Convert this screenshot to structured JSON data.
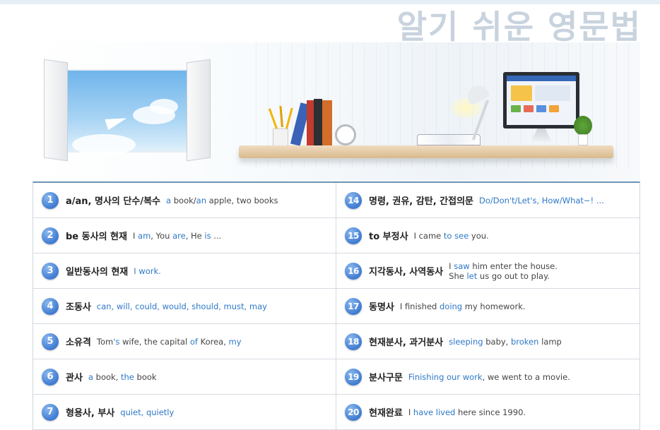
{
  "header": {
    "title": "알기 쉬운 영문법"
  },
  "colors": {
    "accent": "#2e78c7",
    "badge": "#3f7bd1",
    "title_gray": "#c8d3de",
    "table_top": "#6e92b4"
  },
  "grammar_list": {
    "left": [
      {
        "num": "1",
        "topic": "a/an, 명사의 단수/복수",
        "example": [
          [
            "h",
            "a"
          ],
          [
            "n",
            " book/"
          ],
          [
            "h",
            "an"
          ],
          [
            "n",
            " apple, two books"
          ]
        ]
      },
      {
        "num": "2",
        "topic": "be 동사의 현재",
        "example": [
          [
            "n",
            "I "
          ],
          [
            "h",
            "am"
          ],
          [
            "n",
            ", You "
          ],
          [
            "h",
            "are"
          ],
          [
            "n",
            ", He "
          ],
          [
            "h",
            "is"
          ],
          [
            "n",
            " ..."
          ]
        ]
      },
      {
        "num": "3",
        "topic": "일반동사의 현재",
        "example": [
          [
            "h",
            "I work."
          ]
        ]
      },
      {
        "num": "4",
        "topic": "조동사",
        "example": [
          [
            "h",
            "can, will, could, would, should, must, may"
          ]
        ]
      },
      {
        "num": "5",
        "topic": "소유격",
        "example": [
          [
            "n",
            "Tom"
          ],
          [
            "h",
            "'s"
          ],
          [
            "n",
            " wife, the capital "
          ],
          [
            "h",
            "of"
          ],
          [
            "n",
            " Korea, "
          ],
          [
            "h",
            "my"
          ]
        ]
      },
      {
        "num": "6",
        "topic": "관사",
        "example": [
          [
            "h",
            "a"
          ],
          [
            "n",
            " book, "
          ],
          [
            "h",
            "the"
          ],
          [
            "n",
            " book"
          ]
        ]
      },
      {
        "num": "7",
        "topic": "형용사, 부사",
        "example": [
          [
            "h",
            "quiet, quietly"
          ]
        ]
      }
    ],
    "right": [
      {
        "num": "14",
        "topic": "명령, 권유, 감탄, 간접의문",
        "example": [
          [
            "h",
            "Do/Don't/Let's, How/What~! ..."
          ]
        ]
      },
      {
        "num": "15",
        "topic": "to 부정사",
        "example": [
          [
            "n",
            "I came "
          ],
          [
            "h",
            "to see"
          ],
          [
            "n",
            " you."
          ]
        ]
      },
      {
        "num": "16",
        "topic": "지각동사, 사역동사",
        "example": [
          [
            "n",
            "I "
          ],
          [
            "h",
            "saw"
          ],
          [
            "n",
            " him enter the house."
          ]
        ],
        "example2": [
          [
            "n",
            "She "
          ],
          [
            "h",
            "let"
          ],
          [
            "n",
            " us go out to play."
          ]
        ]
      },
      {
        "num": "17",
        "topic": "동명사",
        "example": [
          [
            "n",
            "I finished "
          ],
          [
            "h",
            "doing"
          ],
          [
            "n",
            " my homework."
          ]
        ]
      },
      {
        "num": "18",
        "topic": "현재분사, 과거분사",
        "example": [
          [
            "h",
            "sleeping"
          ],
          [
            "n",
            " baby, "
          ],
          [
            "h",
            "broken"
          ],
          [
            "n",
            " lamp"
          ]
        ]
      },
      {
        "num": "19",
        "topic": "분사구문",
        "example": [
          [
            "h",
            "Finishing our work"
          ],
          [
            "n",
            ", we went to a movie."
          ]
        ]
      },
      {
        "num": "20",
        "topic": "현재완료",
        "example": [
          [
            "n",
            "I "
          ],
          [
            "h",
            "have lived"
          ],
          [
            "n",
            " here since 1990."
          ]
        ]
      }
    ]
  }
}
